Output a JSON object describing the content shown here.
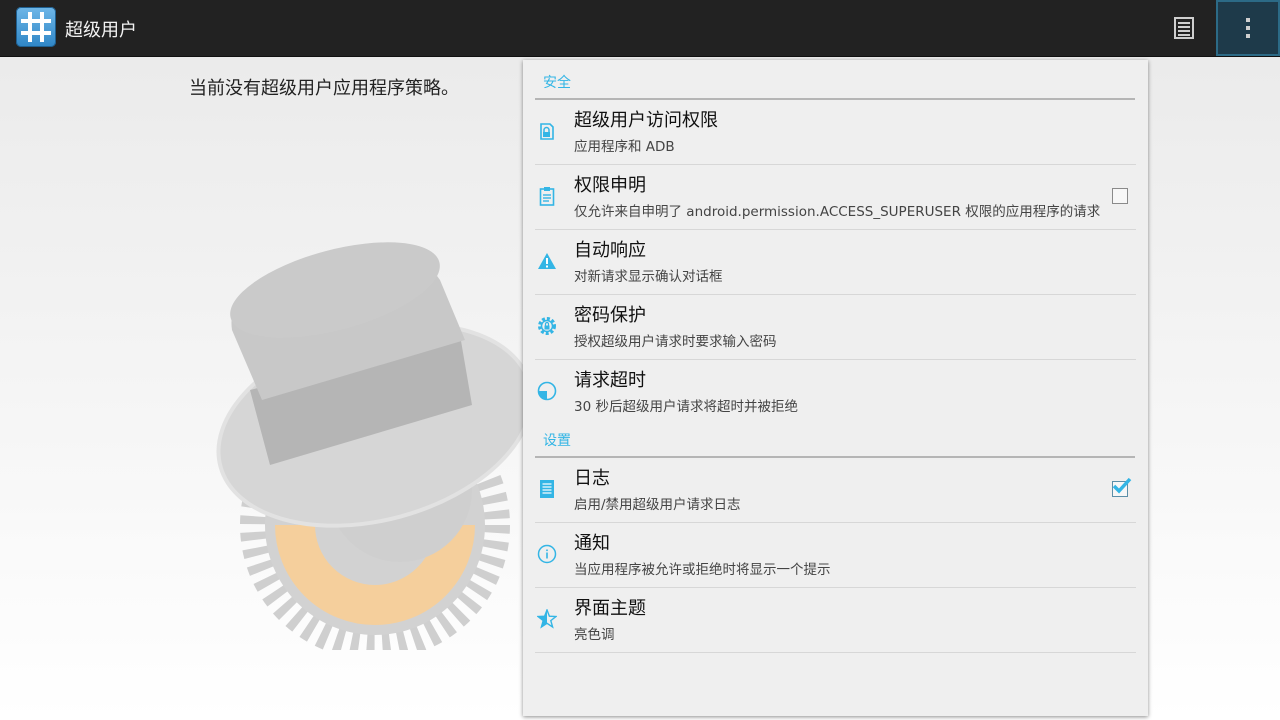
{
  "app": {
    "title": "超级用户"
  },
  "main": {
    "empty_message": "当前没有超级用户应用程序策略。"
  },
  "colors": {
    "accent": "#33b5e5",
    "actionbar": "#222222"
  },
  "actionbar": {
    "icons": [
      "log-list-icon",
      "overflow-menu-icon"
    ]
  },
  "settings": {
    "security_header": "安全",
    "settings_header": "设置",
    "items": [
      {
        "title": "超级用户访问权限",
        "summary": "应用程序和 ADB",
        "icon": "lock-icon"
      },
      {
        "title": "权限申明",
        "summary": "仅允许来自申明了 android.permission.ACCESS_SUPERUSER 权限的应用程序的请求",
        "icon": "clipboard-icon",
        "checked": false
      },
      {
        "title": "自动响应",
        "summary": "对新请求显示确认对话框",
        "icon": "warning-icon"
      },
      {
        "title": "密码保护",
        "summary": "授权超级用户请求时要求输入密码",
        "icon": "gear-lock-icon"
      },
      {
        "title": "请求超时",
        "summary": "30 秒后超级用户请求将超时并被拒绝",
        "icon": "timer-icon"
      },
      {
        "title": "日志",
        "summary": "启用/禁用超级用户请求日志",
        "icon": "log-icon",
        "checked": true
      },
      {
        "title": "通知",
        "summary": "当应用程序被允许或拒绝时将显示一个提示",
        "icon": "info-icon"
      },
      {
        "title": "界面主题",
        "summary": "亮色调",
        "icon": "star-icon"
      }
    ]
  }
}
